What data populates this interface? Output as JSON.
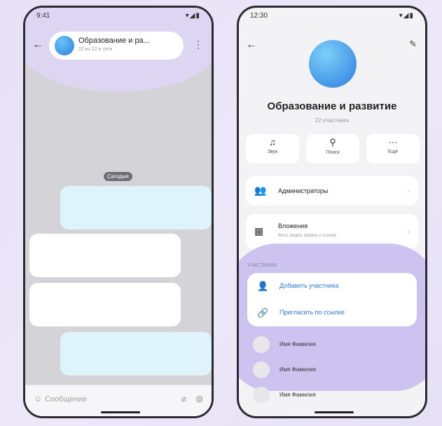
{
  "left_screen": {
    "status_time": "9:41",
    "status_icons": "▾◢▮",
    "chat_title": "Образование и ра...",
    "chat_subtitle": "22 из 22 в сети",
    "date_badge": "Сегодня",
    "composer_placeholder": "Сообщение"
  },
  "right_screen": {
    "status_time": "12:30",
    "status_icons": "▾◢▮",
    "group_title": "Образование и развитие",
    "group_subtitle": "22 участника",
    "actions": [
      {
        "icon": "bell-icon",
        "label": "Звук"
      },
      {
        "icon": "search-icon",
        "label": "Поиск"
      },
      {
        "icon": "more-icon",
        "label": "Ещё"
      }
    ],
    "menu": [
      {
        "icon": "admins-icon",
        "label": "Администраторы",
        "sublabel": ""
      },
      {
        "icon": "attachments-icon",
        "label": "Вложения",
        "sublabel": "Фото, видео, файлы и ссылки"
      }
    ],
    "members_section_label": "УЧАСТНИКИ",
    "invite_actions": [
      {
        "icon": "add-user-icon",
        "label": "Добавить участника"
      },
      {
        "icon": "link-icon",
        "label": "Пригласить по ссылке"
      }
    ],
    "members": [
      {
        "name": "Имя Фамилия"
      },
      {
        "name": "Имя Фамилия"
      },
      {
        "name": "Имя Фамилия"
      }
    ]
  },
  "colors": {
    "accent": "#2e7be8",
    "highlight": "#c4baf0",
    "outgoing_bubble": "#dff3fb"
  }
}
